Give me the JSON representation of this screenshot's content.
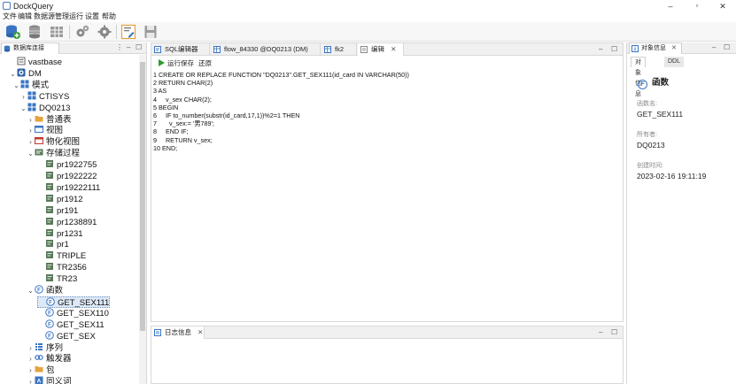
{
  "window": {
    "title": "DockQuery",
    "minimize": "–",
    "maximize": "▫",
    "close": "✕"
  },
  "menu": [
    "文件",
    "编辑",
    "数据源管理",
    "运行",
    "设置",
    "帮助"
  ],
  "toolbar": {
    "buttons": [
      "add-datasource-icon",
      "database-icon",
      "table-icon",
      "gear-icon",
      "settings-cog-icon",
      "edit-document-icon",
      "save-icon"
    ]
  },
  "left_panel": {
    "tab_label": "数据库连接",
    "min": "–",
    "max": "☐",
    "menu": "⋮",
    "tree": [
      {
        "label": "vastbase",
        "level": 0,
        "arrow": "",
        "icon": "server-icon"
      },
      {
        "label": "DM",
        "level": 0,
        "arrow": "⌄",
        "icon": "dm-database-icon"
      },
      {
        "label": "模式",
        "level": 1,
        "arrow": "⌄",
        "icon": "schema-icon"
      },
      {
        "label": "CTISYS",
        "level": 2,
        "arrow": "›",
        "icon": "schema-item-icon"
      },
      {
        "label": "DQ0213",
        "level": 2,
        "arrow": "⌄",
        "icon": "schema-item-icon"
      },
      {
        "label": "普通表",
        "level": 3,
        "arrow": "›",
        "icon": "folder-icon"
      },
      {
        "label": "视图",
        "level": 3,
        "arrow": "›",
        "icon": "view-icon"
      },
      {
        "label": "物化视图",
        "level": 3,
        "arrow": "›",
        "icon": "materialized-view-icon"
      },
      {
        "label": "存储过程",
        "level": 3,
        "arrow": "⌄",
        "icon": "procedure-folder-icon"
      },
      {
        "label": "pr1922755",
        "level": 4,
        "arrow": "",
        "icon": "procedure-icon"
      },
      {
        "label": "pr1922222",
        "level": 4,
        "arrow": "",
        "icon": "procedure-icon"
      },
      {
        "label": "pr19222111",
        "level": 4,
        "arrow": "",
        "icon": "procedure-icon"
      },
      {
        "label": "pr1912",
        "level": 4,
        "arrow": "",
        "icon": "procedure-icon"
      },
      {
        "label": "pr191",
        "level": 4,
        "arrow": "",
        "icon": "procedure-icon"
      },
      {
        "label": "pr1238891",
        "level": 4,
        "arrow": "",
        "icon": "procedure-icon"
      },
      {
        "label": "pr1231",
        "level": 4,
        "arrow": "",
        "icon": "procedure-icon"
      },
      {
        "label": "pr1",
        "level": 4,
        "arrow": "",
        "icon": "procedure-icon"
      },
      {
        "label": "TRIPLE",
        "level": 4,
        "arrow": "",
        "icon": "procedure-icon"
      },
      {
        "label": "TR2356",
        "level": 4,
        "arrow": "",
        "icon": "procedure-icon"
      },
      {
        "label": "TR23",
        "level": 4,
        "arrow": "",
        "icon": "procedure-icon"
      },
      {
        "label": "函数",
        "level": 3,
        "arrow": "⌄",
        "icon": "function-folder-icon"
      },
      {
        "label": "GET_SEX111",
        "level": 4,
        "arrow": "",
        "icon": "function-icon",
        "selected": true
      },
      {
        "label": "GET_SEX110",
        "level": 4,
        "arrow": "",
        "icon": "function-icon"
      },
      {
        "label": "GET_SEX11",
        "level": 4,
        "arrow": "",
        "icon": "function-icon"
      },
      {
        "label": "GET_SEX",
        "level": 4,
        "arrow": "",
        "icon": "function-icon"
      },
      {
        "label": "序列",
        "level": 3,
        "arrow": "›",
        "icon": "sequence-icon"
      },
      {
        "label": "触发器",
        "level": 3,
        "arrow": "›",
        "icon": "trigger-icon"
      },
      {
        "label": "包",
        "level": 3,
        "arrow": "›",
        "icon": "package-icon"
      },
      {
        "label": "同义词",
        "level": 3,
        "arrow": "›",
        "icon": "synonym-icon"
      }
    ]
  },
  "editor": {
    "tabs": [
      {
        "label": "SQL编辑器",
        "icon": "sql-editor-icon",
        "active": false
      },
      {
        "label": "flow_84330 @DQ0213 (DM)",
        "icon": "table-icon",
        "active": false
      },
      {
        "label": "fk2",
        "icon": "table-icon",
        "active": false
      },
      {
        "label": "编辑",
        "icon": "edit-icon",
        "active": true,
        "close": "✕"
      }
    ],
    "min": "–",
    "max": "☐",
    "run_label": "运行保存",
    "restore_label": "还原",
    "code_lines": [
      "1 CREATE OR REPLACE FUNCTION \"DQ0213\".GET_SEX111(id_card IN VARCHAR(50))",
      "2 RETURN CHAR(2)",
      "3 AS",
      "4     v_sex CHAR(2);",
      "5 BEGIN",
      "6     IF to_number(substr(id_card,17,1))%2=1 THEN",
      "7       v_sex:= '男789';",
      "8     END IF;",
      "9     RETURN v_sex;",
      "10 END;"
    ]
  },
  "log_panel": {
    "tab_label": "日志信息",
    "close": "✕",
    "min": "–",
    "max": "☐"
  },
  "right_panel": {
    "tab_label": "对象信息",
    "close": "✕",
    "min": "–",
    "max": "☐",
    "subtabs": [
      "对象信息",
      "DDL"
    ],
    "object_type": "函数",
    "props": [
      {
        "label": "函数名:",
        "value": "GET_SEX111"
      },
      {
        "label": "所有者:",
        "value": "DQ0213"
      },
      {
        "label": "创建时间:",
        "value": "2023-02-16 19:11:19"
      }
    ]
  },
  "colors": {
    "accent": "#3a75c4",
    "procedure_icon": "#5a7a5a",
    "folder": "#e6a23c",
    "selection": "#dde9f7",
    "run_green": "#2e9b2e"
  }
}
